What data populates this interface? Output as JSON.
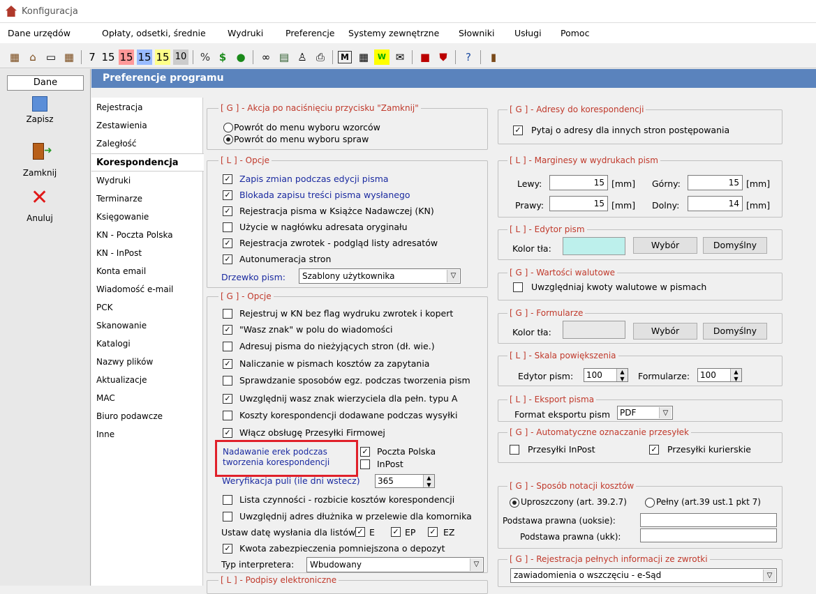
{
  "window": {
    "title": "Konfiguracja"
  },
  "menu": [
    "Dane urzędów",
    "Opłaty, odsetki, średnie",
    "Wydruki",
    "Preferencje",
    "Systemy zewnętrzne",
    "Słowniki",
    "Usługi",
    "Pomoc"
  ],
  "toolbar": {
    "numbers": [
      "7",
      "15",
      "15",
      "15",
      "15",
      "10"
    ],
    "symbols": [
      "%",
      "$"
    ]
  },
  "left_panel": {
    "tab": "Dane",
    "buttons": [
      {
        "label": "Zapisz",
        "icon": "save-icon"
      },
      {
        "label": "Zamknij",
        "icon": "exit-door-icon"
      },
      {
        "label": "Anuluj",
        "icon": "cancel-x-icon"
      }
    ]
  },
  "header": {
    "title": "Preferencje programu"
  },
  "nav": [
    "Rejestracja",
    "Zestawienia",
    "Zaległość",
    "Korespondencja",
    "Wydruki",
    "Terminarze",
    "Księgowanie",
    "KN - Poczta Polska",
    "KN - InPost",
    "Konta email",
    "Wiadomość e-mail",
    "PCK",
    "Skanowanie",
    "Katalogi",
    "Nazwy plików",
    "Aktualizacje",
    "MAC",
    "Biuro podawcze",
    "Inne"
  ],
  "nav_selected": "Korespondencja",
  "g_akcja": {
    "title": "[ G ] - Akcja po naciśnięciu przycisku \"Zamknij\"",
    "options": [
      {
        "label": "Powrót do menu wyboru wzorców",
        "selected": false
      },
      {
        "label": "Powrót do menu wyboru spraw",
        "selected": true
      }
    ]
  },
  "l_opcje": {
    "title": "[ L ] - Opcje",
    "items": [
      {
        "label": "Zapis zmian podczas edycji pisma",
        "checked": true
      },
      {
        "label": "Blokada zapisu treści pisma wysłanego",
        "checked": true
      },
      {
        "label": "Rejestracja pisma w Książce Nadawczej (KN)",
        "checked": true
      },
      {
        "label": "Użycie w nagłówku adresata oryginału",
        "checked": false
      },
      {
        "label": "Rejestracja zwrotek - podgląd listy adresatów",
        "checked": true
      },
      {
        "label": "Autonumeracja stron",
        "checked": true
      }
    ],
    "drzewko_label": "Drzewko pism:",
    "drzewko_value": "Szablony użytkownika"
  },
  "g_opcje": {
    "title": "[ G ] - Opcje",
    "items": [
      {
        "label": "Rejestruj w KN bez flag wydruku zwrotek i kopert",
        "checked": false
      },
      {
        "label": "\"Wasz znak\" w polu do wiadomości",
        "checked": true
      },
      {
        "label": "Adresuj pisma do nieżyjących stron (dł. wie.)",
        "checked": false
      },
      {
        "label": "Naliczanie w pismach kosztów za zapytania",
        "checked": true
      },
      {
        "label": "Sprawdzanie sposobów egz. podczas tworzenia pism",
        "checked": false
      },
      {
        "label": "Uwzględnij wasz znak wierzyciela dla pełn. typu A",
        "checked": true
      },
      {
        "label": "Koszty korespondencji dodawane podczas wysyłki",
        "checked": false
      },
      {
        "label": "Włącz obsługę Przesyłki Firmowej",
        "checked": true
      }
    ],
    "nadawanie_line1": "Nadawanie erek podczas",
    "nadawanie_line2": "tworzenia korespondencji",
    "poczta": {
      "label": "Poczta Polska",
      "checked": true
    },
    "inpost": {
      "label": "InPost",
      "checked": false
    },
    "weryfikacja_label": "Weryfikacja puli (ile dni wstecz)",
    "weryfikacja_value": "365",
    "items2": [
      {
        "label": "Lista czynności - rozbicie kosztów korespondencji",
        "checked": false
      },
      {
        "label": "Uwzględnij adres dłużnika w przelewie dla komornika",
        "checked": false
      }
    ],
    "data_label": "Ustaw datę wysłania dla listów",
    "data_opts": [
      {
        "label": "E",
        "checked": true
      },
      {
        "label": "EP",
        "checked": true
      },
      {
        "label": "EZ",
        "checked": true
      }
    ],
    "kwota": {
      "label": "Kwota zabezpieczenia pomniejszona o depozyt",
      "checked": true
    },
    "typ_label": "Typ interpretera:",
    "typ_value": "Wbudowany"
  },
  "l_podpisy": {
    "title": "[ L ] - Podpisy elektroniczne"
  },
  "g_adresy": {
    "title": "[ G ] - Adresy do korespondencji",
    "item": {
      "label": "Pytaj o adresy dla innych stron postępowania",
      "checked": true
    }
  },
  "l_marginesy": {
    "title": "[ L ] - Marginesy w wydrukach pism",
    "lewy_label": "Lewy:",
    "lewy": "15",
    "gorny_label": "Górny:",
    "gorny": "15",
    "prawy_label": "Prawy:",
    "prawy": "15",
    "dolny_label": "Dolny:",
    "dolny": "14",
    "unit": "[mm]"
  },
  "l_edytor": {
    "title": "[ L ] - Edytor pism",
    "kolor_label": "Kolor tła:",
    "color": "#bdf0ec",
    "wybor": "Wybór",
    "domyslny": "Domyślny"
  },
  "g_walutowe": {
    "title": "[ G ] - Wartości walutowe",
    "item": {
      "label": "Uwzględniaj kwoty walutowe w pismach",
      "checked": false
    }
  },
  "g_formularze": {
    "title": "[ G ] - Formularze",
    "kolor_label": "Kolor tła:",
    "color": "#e8e8e8",
    "wybor": "Wybór",
    "domyslny": "Domyślny"
  },
  "l_skala": {
    "title": "[ L ] - Skala powiększenia",
    "edytor_label": "Edytor pism:",
    "edytor_value": "100",
    "form_label": "Formularze:",
    "form_value": "100"
  },
  "l_eksport": {
    "title": "[ L ] - Eksport pisma",
    "label": "Format eksportu pism",
    "value": "PDF"
  },
  "g_auto": {
    "title": "[ G ] - Automatyczne oznaczanie przesyłek",
    "items": [
      {
        "label": "Przesyłki InPost",
        "checked": false
      },
      {
        "label": "Przesyłki kurierskie",
        "checked": true
      }
    ]
  },
  "g_sposob": {
    "title": "[ G ] - Sposób notacji kosztów",
    "opt1": "Uproszczony (art. 39.2.7)",
    "opt2": "Pełny (art.39 ust.1 pkt 7)",
    "uoksie_label": "Podstawa prawna (uoksie):",
    "ukk_label": "Podstawa prawna (ukk):"
  },
  "g_rejestracja": {
    "title": "[ G ] - Rejestracja pełnych informacji ze zwrotki",
    "value": "zawiadomienia o wszczęciu - e-Sąd"
  }
}
